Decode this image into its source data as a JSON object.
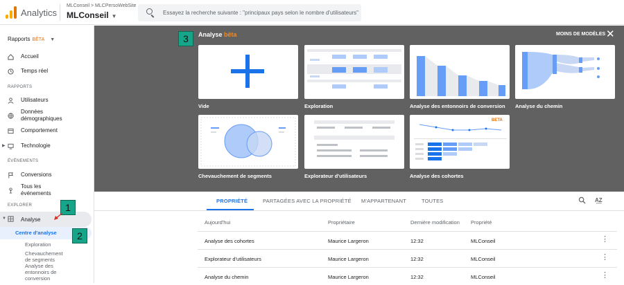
{
  "topbar": {
    "app_title": "Analytics",
    "breadcrumb": "MLConseil > MLCPersoWebSite",
    "account": "MLConseil",
    "search_placeholder": "Essayez la recherche suivante : \"principaux pays selon le nombre d'utilisateurs\""
  },
  "sidebar": {
    "rapports_label": "Rapports",
    "rapports_beta": "BÊTA",
    "accueil": "Accueil",
    "temps_reel": "Temps réel",
    "section_rapports": "RAPPORTS",
    "utilisateurs": "Utilisateurs",
    "donnees_demo_1": "Données",
    "donnees_demo_2": "démographiques",
    "comportement": "Comportement",
    "technologie": "Technologie",
    "section_evenements": "ÉVÉNEMENTS",
    "conversions": "Conversions",
    "tous_evenements_1": "Tous les",
    "tous_evenements_2": "événements",
    "section_explorer": "EXPLORER",
    "analyse": "Analyse",
    "centre_analyse": "Centre d'analyse",
    "exploration": "Exploration",
    "chevauchement_1": "Chevauchement",
    "chevauchement_2": "de segments",
    "entonnoirs_1": "Analyse des",
    "entonnoirs_2": "entonnoirs de",
    "entonnoirs_3": "conversion"
  },
  "gallery": {
    "title": "Analyse",
    "title_beta": "bêta",
    "fewer_templates": "MOINS DE MODÈLES",
    "cards": [
      {
        "label": "Vide"
      },
      {
        "label": "Exploration"
      },
      {
        "label": "Analyse des entonnoirs de conversion"
      },
      {
        "label": "Analyse du chemin"
      },
      {
        "label": "Chevauchement de segments"
      },
      {
        "label": "Explorateur d'utilisateurs"
      },
      {
        "label": "Analyse des cohortes",
        "badge": "BETA"
      }
    ]
  },
  "badges": [
    "1",
    "2",
    "3"
  ],
  "tabs": [
    "PROPRIÉTÉ",
    "PARTAGÉES AVEC LA PROPRIÉTÉ",
    "M'APPARTENANT",
    "TOUTES"
  ],
  "table": {
    "headers": [
      "Aujourd'hui",
      "Propriétaire",
      "Dernière modification",
      "Propriété"
    ],
    "rows": [
      [
        "Analyse des cohortes",
        "Maurice Largeron",
        "12:32",
        "MLConseil"
      ],
      [
        "Explorateur d'utilisateurs",
        "Maurice Largeron",
        "12:32",
        "MLConseil"
      ],
      [
        "Analyse du chemin",
        "Maurice Largeron",
        "12:32",
        "MLConseil"
      ]
    ]
  },
  "colors": {
    "accent_blue": "#1a73e8",
    "beta_orange": "#e8710a",
    "gallery_bg": "#616161",
    "badge_green": "#17a589"
  },
  "icons": [
    "analytics-logo-icon",
    "search-icon",
    "home-icon",
    "clock-icon",
    "person-icon",
    "globe-icon",
    "layout-icon",
    "monitor-icon",
    "flag-icon",
    "touch-icon",
    "analysis-icon",
    "close-icon",
    "sort-az-icon",
    "kebab-menu-icon"
  ]
}
